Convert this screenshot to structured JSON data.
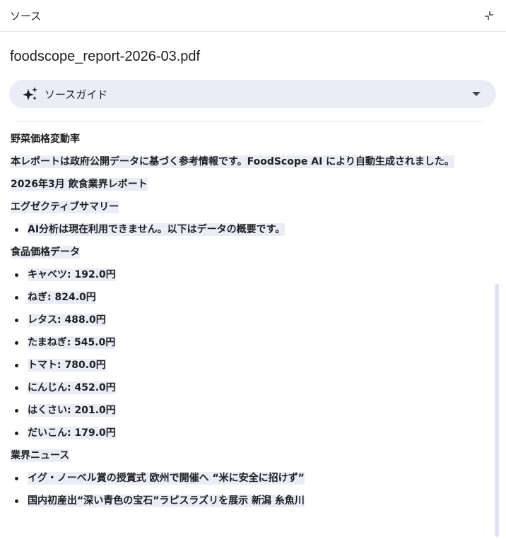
{
  "header": {
    "title": "ソース"
  },
  "document": {
    "filename": "foodscope_report-2026-03.pdf"
  },
  "source_guide": {
    "label": "ソースガイド",
    "icon": "sparkle-icon",
    "chevron": "chevron-down-icon"
  },
  "content": {
    "heading_price_change": "野菜価格変動率",
    "disclaimer": "本レポートは政府公開データに基づく参考情報です。FoodScope AI により自動生成されました。",
    "report_title": "2026年3月 飲食業界レポート",
    "executive_summary_heading": "エグゼクティブサマリー",
    "summary_items": [
      "AI分析は現在利用できません。以下はデータの概要です。"
    ],
    "price_data_heading": "食品価格データ",
    "price_items": [
      "キャベツ: 192.0円",
      "ねぎ: 824.0円",
      "レタス: 488.0円",
      "たまねぎ: 545.0円",
      "トマト: 780.0円",
      "にんじん: 452.0円",
      "はくさい: 201.0円",
      "だいこん: 179.0円"
    ],
    "news_heading": "業界ニュース",
    "news_items": [
      "イグ・ノーベル賞の授賞式 欧州で開催へ “米に安全に招けず”",
      "国内初産出“深い青色の宝石”ラピスラズリを展示 新潟 糸魚川"
    ]
  },
  "colors": {
    "highlight": "#eaedf6",
    "guide_bg": "#eaedf6",
    "text": "#1f1f1f",
    "scrollbar": "#dde3f0"
  }
}
